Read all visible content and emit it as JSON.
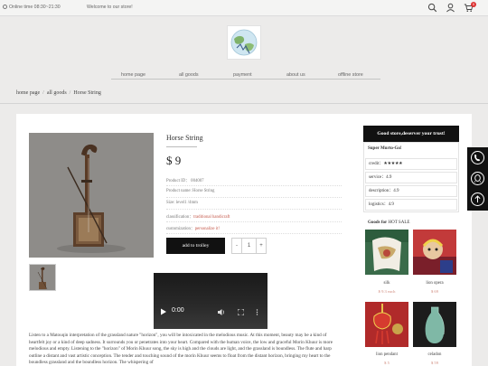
{
  "topbar": {
    "online_time": "Online time 08:30~21:30",
    "welcome": "Welcome to our store!",
    "cart_count": "0"
  },
  "nav": {
    "items": [
      "home page",
      "all goods",
      "payment",
      "about us",
      "offline store"
    ]
  },
  "breadcrumb": {
    "home": "home page",
    "all_goods": "all goods",
    "current": "Horse String"
  },
  "product": {
    "title": "Horse String",
    "price": "$ 9",
    "product_id": "Product ID：  004007",
    "product_name": "Product name: Horse String",
    "size": "Size: level1 /4mm",
    "classification_label": "classification：",
    "classification_value": "traditional handicraft",
    "customization_label": "customization：",
    "customization_value": "personalize it!",
    "add_to_trolley": "add to trolley",
    "qty_minus": "-",
    "qty_value": "1",
    "qty_plus": "+"
  },
  "video": {
    "time": "0:00"
  },
  "description": "Listen to a Matouqin interpretation of the grassland nature \"horizon\", you will be intoxicated in the melodious music. At this moment, beauty may be a kind of heartfelt joy or a kind of deep sadness. It surrounds you or penetrates into your heart. Compared with the human voice, the low and graceful Morin Khuur is more melodious and empty. Listening to the \"horizon\" of Morin Khuur song, the sky is high and the clouds are light, and the grassland is boundless. The flute and harp outline a distant and vast artistic conception. The tender and touching sound of the morin Khuur seems to float from the distant horizon, bringing my heart to the boundless grassland and the boundless horizon. The whispering of",
  "sidebar": {
    "header": "Good store,deserver your trust!",
    "store_name": "Super Murto-Go!",
    "rows": [
      {
        "label": "credit：",
        "value": "★★★★★"
      },
      {
        "label": "service：",
        "value": "4.9"
      },
      {
        "label": "description：",
        "value": "4.9"
      },
      {
        "label": "logistics：",
        "value": "4.9"
      }
    ],
    "goods_title_prefix": "Goods for",
    "goods_title_suffix": " HOT SALE",
    "goods": [
      {
        "name": "silk",
        "price": "$ 9.3 each"
      },
      {
        "name": "lion opera",
        "price": "$ 69"
      },
      {
        "name": "lion pendant",
        "price": "$ 5"
      },
      {
        "name": "celadon",
        "price": "$ 59"
      }
    ]
  },
  "icons": {
    "topbar": [
      "clock-icon",
      "search-icon",
      "user-icon",
      "cart-icon"
    ],
    "float_bar": [
      "phone-icon",
      "qq-icon",
      "back-to-top-icon"
    ]
  }
}
